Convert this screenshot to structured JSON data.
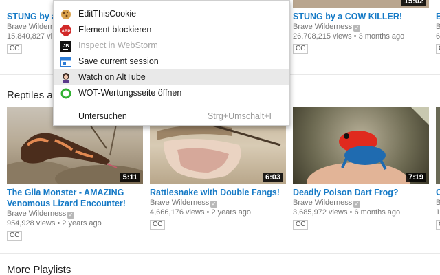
{
  "top_row": [
    {
      "title": "STUNG by a",
      "channel": "Brave Wilderness",
      "meta": "15,840,827 vi",
      "cc": "CC"
    },
    {
      "title": "STUNG by a COW KILLER!",
      "channel": "Brave Wilderness",
      "meta": "26,708,215 views • 3 months ago",
      "cc": "CC",
      "duration": "15:02"
    },
    {
      "title": "B",
      "channel": "B",
      "meta": "6",
      "cc": "C"
    }
  ],
  "section_reptiles": "Reptiles a",
  "section_more": "More Playlists",
  "videos": [
    {
      "title_line1": "The Gila Monster - AMAZING",
      "title_line2": "Venomous Lizard Encounter!",
      "channel": "Brave Wilderness",
      "meta": "954,928 views • 2 years ago",
      "cc": "CC",
      "duration": "5:11"
    },
    {
      "title_line1": "Rattlesnake with Double Fangs!",
      "title_line2": "",
      "channel": "Brave Wilderness",
      "meta": "4,666,176 views • 2 years ago",
      "cc": "CC",
      "duration": "6:03"
    },
    {
      "title_line1": "Deadly Poison Dart Frog?",
      "title_line2": "",
      "channel": "Brave Wilderness",
      "meta": "3,685,972 views • 6 months ago",
      "cc": "CC",
      "duration": "7:19"
    },
    {
      "title_line1": "C",
      "title_line2": "",
      "channel": "B",
      "meta": "1",
      "cc": "C",
      "duration": ""
    }
  ],
  "context_menu": {
    "items": [
      {
        "label": "EditThisCookie",
        "icon": "cookie-icon",
        "state": "normal"
      },
      {
        "label": "Element blockieren",
        "icon": "adblock-icon",
        "state": "normal"
      },
      {
        "label": "Inspect in WebStorm",
        "icon": "webstorm-icon",
        "state": "disabled"
      },
      {
        "label": "Save current session",
        "icon": "session-icon",
        "state": "normal"
      },
      {
        "label": "Watch on AltTube",
        "icon": "alttube-icon",
        "state": "hover"
      },
      {
        "label": "WOT-Wertungsseite öffnen",
        "icon": "wot-icon",
        "state": "normal"
      }
    ],
    "inspect": {
      "label": "Untersuchen",
      "shortcut": "Strg+Umschalt+I"
    },
    "icon_text": {
      "adblock": "ABP",
      "webstorm": "JB"
    }
  },
  "colors": {
    "link": "#167ac6",
    "meta": "#767676",
    "accent_fold": "#e6ac00",
    "menu_hover": "#e9e9e9"
  }
}
